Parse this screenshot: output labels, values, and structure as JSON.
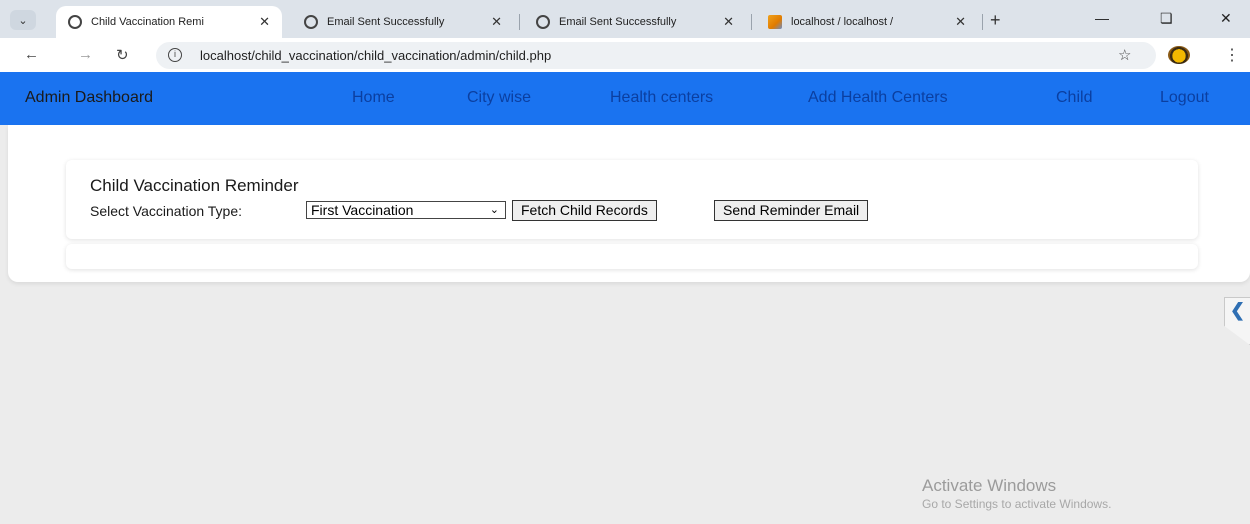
{
  "browser": {
    "tabs": [
      {
        "title": "Child Vaccination Remi",
        "icon": "globe-icon"
      },
      {
        "title": "Email Sent Successfully",
        "icon": "globe-icon"
      },
      {
        "title": "Email Sent Successfully",
        "icon": "globe-icon"
      },
      {
        "title": "localhost / localhost / ",
        "icon": "phpmyadmin-icon"
      }
    ],
    "url": "localhost/child_vaccination/child_vaccination/admin/child.php"
  },
  "navbar": {
    "brand": "Admin Dashboard",
    "links": [
      "Home",
      "City wise",
      "Health centers",
      "Add Health Centers",
      "Child",
      "Logout"
    ],
    "background": "#1a73f0"
  },
  "reminder": {
    "title": "Child Vaccination Reminder",
    "select_label": "Select Vaccination Type:",
    "selected_option": "First Vaccination",
    "fetch_button": "Fetch Child Records",
    "send_button": "Send Reminder Email"
  },
  "watermark": {
    "line1": "Activate Windows",
    "line2": "Go to Settings to activate Windows."
  }
}
